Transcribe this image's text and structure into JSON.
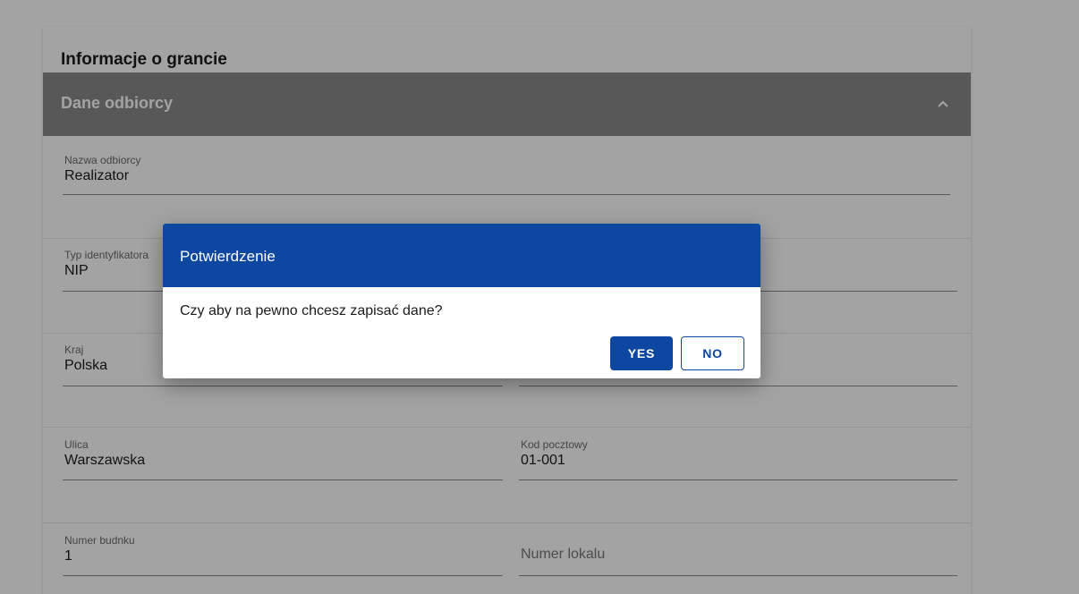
{
  "card": {
    "title": "Informacje o grancie",
    "section": {
      "title": "Dane odbiorcy",
      "toggle_icon": "chevron-up-icon"
    },
    "fields": {
      "nazwa_odbiorcy": {
        "label": "Nazwa odbiorcy",
        "value": "Realizator"
      },
      "typ_identyfikatora": {
        "label": "Typ identyfikatora",
        "value": "NIP"
      },
      "kraj": {
        "label": "Kraj",
        "value": "Polska"
      },
      "ulica": {
        "label": "Ulica",
        "value": "Warszawska"
      },
      "kod_pocztowy": {
        "label": "Kod pocztowy",
        "value": "01-001"
      },
      "numer_budynku": {
        "label": "Numer budnku",
        "value": "1"
      },
      "numer_lokalu": {
        "placeholder": "Numer lokalu"
      }
    }
  },
  "dialog": {
    "title": "Potwierdzenie",
    "message": "Czy aby na pewno chcesz zapisać dane?",
    "yes_label": "YES",
    "no_label": "NO"
  },
  "colors": {
    "primary": "#0d47a1",
    "section_header": "#8a8a8a",
    "overlay": "rgba(0,0,0,0.36)"
  }
}
